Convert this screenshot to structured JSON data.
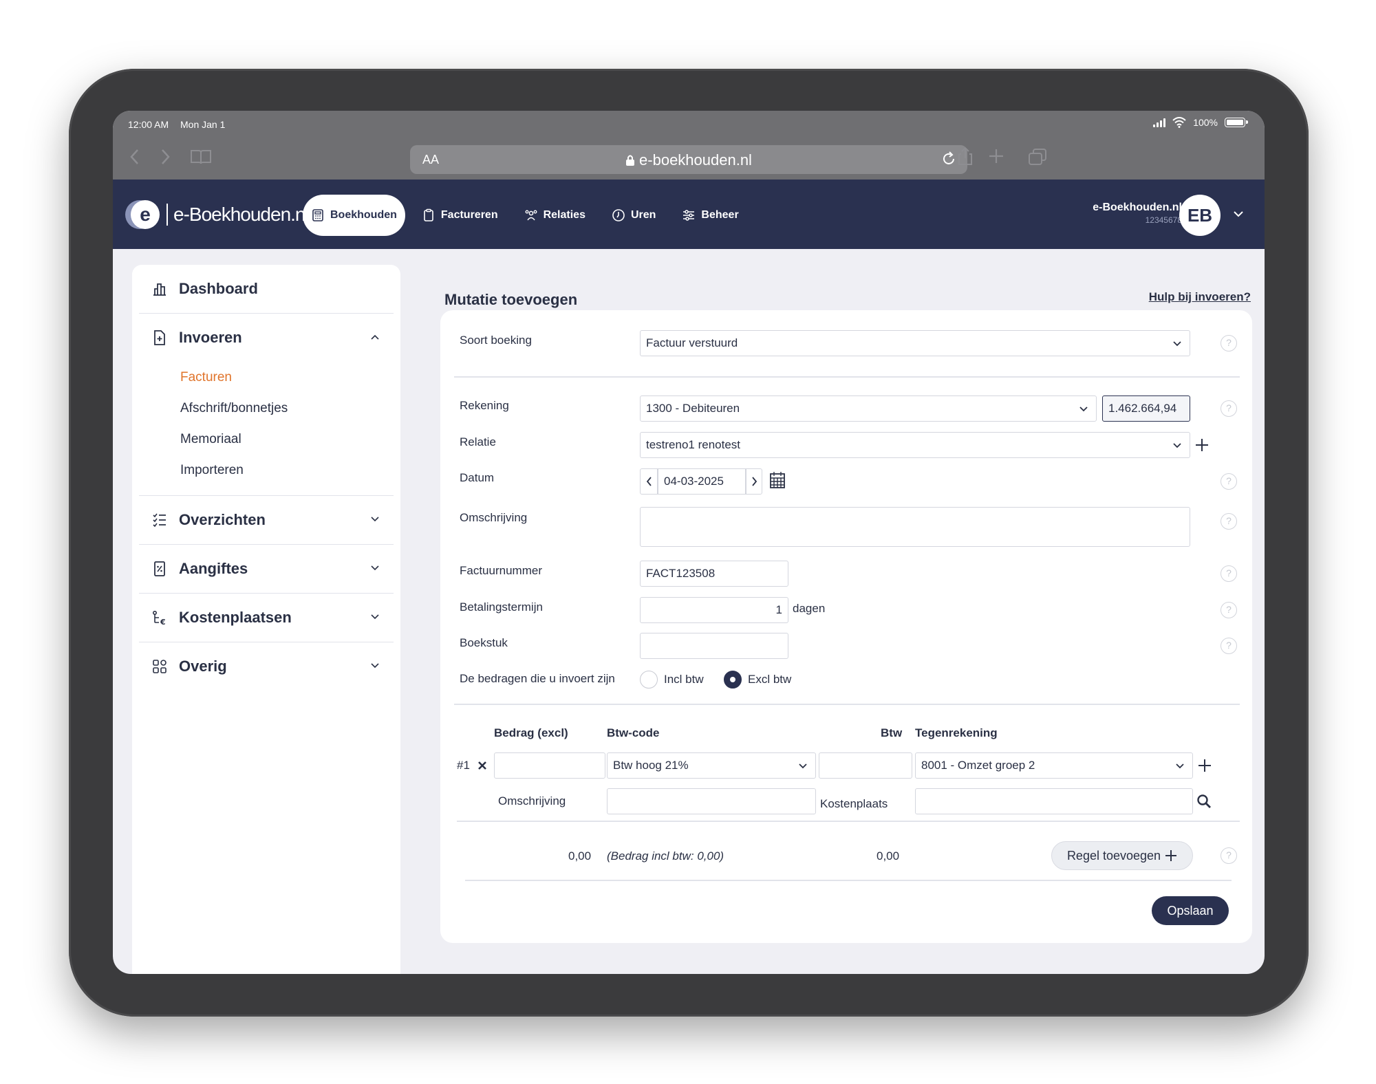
{
  "status_bar": {
    "time": "12:00 AM",
    "date": "Mon Jan 1",
    "battery": "100%"
  },
  "browser": {
    "text_size": "AA",
    "url": "e-boekhouden.nl"
  },
  "header": {
    "logo": "e-Boekhouden.nl",
    "nav": [
      "Boekhouden",
      "Factureren",
      "Relaties",
      "Uren",
      "Beheer"
    ],
    "active_nav": "Boekhouden",
    "company": "e-Boekhouden.nl",
    "company_id": "12345678",
    "avatar_initials": "EB"
  },
  "sidebar": {
    "dashboard": "Dashboard",
    "invoeren": {
      "label": "Invoeren",
      "items": [
        "Facturen",
        "Afschrift/bonnetjes",
        "Memoriaal",
        "Importeren"
      ],
      "active": "Facturen"
    },
    "overzichten": "Overzichten",
    "aangiftes": "Aangiftes",
    "kostenplaatsen": "Kostenplaatsen",
    "overig": "Overig"
  },
  "main": {
    "title": "Mutatie toevoegen",
    "help": "Hulp bij invoeren?",
    "form": {
      "soort_label": "Soort boeking",
      "soort_value": "Factuur verstuurd",
      "rekening_label": "Rekening",
      "rekening_value": "1300 - Debiteuren",
      "rekening_saldo": "1.462.664,94",
      "relatie_label": "Relatie",
      "relatie_value": "testreno1 renotest",
      "datum_label": "Datum",
      "datum_value": "04-03-2025",
      "omschrijving_label": "Omschrijving",
      "omschrijving_value": "",
      "factuurnummer_label": "Factuurnummer",
      "factuurnummer_value": "FACT123508",
      "betalingstermijn_label": "Betalingstermijn",
      "betalingstermijn_value": "1",
      "betalingstermijn_unit": "dagen",
      "boekstuk_label": "Boekstuk",
      "boekstuk_value": "",
      "bedragen_label": "De bedragen die u invoert zijn",
      "incl_label": "Incl btw",
      "excl_label": "Excl btw",
      "selected_btw_mode": "Excl btw"
    },
    "lines": {
      "headers": {
        "bedrag": "Bedrag (excl)",
        "btw_code": "Btw-code",
        "btw": "Btw",
        "tegenrekening": "Tegenrekening"
      },
      "row": {
        "number": "#1",
        "bedrag": "",
        "btw_code": "Btw hoog 21%",
        "btw": "",
        "tegenrekening": "8001 - Omzet groep 2",
        "omschrijving_label": "Omschrijving",
        "omschrijving": "",
        "kostenplaats_label": "Kostenplaats",
        "kostenplaats": ""
      },
      "totals": {
        "bedrag": "0,00",
        "incl": "(Bedrag incl btw: 0,00)",
        "btw": "0,00"
      },
      "add_line": "Regel toevoegen"
    },
    "save": "Opslaan"
  }
}
